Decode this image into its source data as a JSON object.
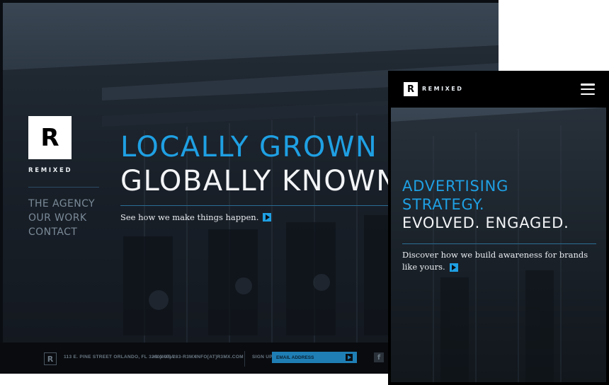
{
  "desktop": {
    "brand": {
      "letter": "R",
      "word": "REMIXED"
    },
    "nav": [
      "THE AGENCY",
      "OUR WORK",
      "CONTACT"
    ],
    "hero": {
      "line1": "LOCALLY GROWN",
      "line2": "GLOBALLY KNOWN",
      "cta": "See how we make things happen."
    },
    "footer": {
      "logo_letter": "R",
      "address": "113 E. PINE STREET ORLANDO, FL 32801 USA",
      "phone": "+1 (407) 283-R3MX",
      "email": "INFO[AT]R3MX.COM",
      "signup_label": "SIGN UP",
      "email_placeholder": "EMAIL ADDRESS",
      "facebook_letter": "f"
    }
  },
  "mobile": {
    "brand": {
      "letter": "R",
      "word": "REMIXED"
    },
    "hero": {
      "line1": "ADVERTISING",
      "line2": "STRATEGY.",
      "line3": "EVOLVED. ENGAGED.",
      "cta": "Discover how we build awareness for brands like yours."
    }
  },
  "colors": {
    "accent": "#1fa0e3",
    "background": "#0a0d12",
    "text": "#f2f4f6"
  }
}
